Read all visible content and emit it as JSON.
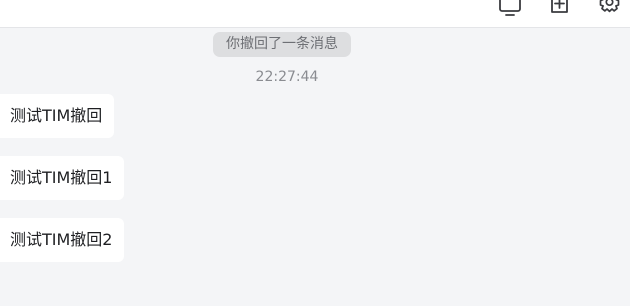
{
  "toolbar": {
    "icons": [
      "screen-share-icon",
      "add-member-icon",
      "settings-gear-icon"
    ]
  },
  "chat": {
    "recall_notice": "你撤回了一条消息",
    "timestamp": "22:27:44",
    "messages": [
      {
        "text": "测试TIM撤回"
      },
      {
        "text": "测试TIM撤回1"
      },
      {
        "text": "测试TIM撤回2"
      }
    ]
  },
  "colors": {
    "background": "#f4f5f7",
    "bubble": "#ffffff",
    "notice_pill": "#dddee0",
    "icon_stroke": "#3a3b3f"
  }
}
